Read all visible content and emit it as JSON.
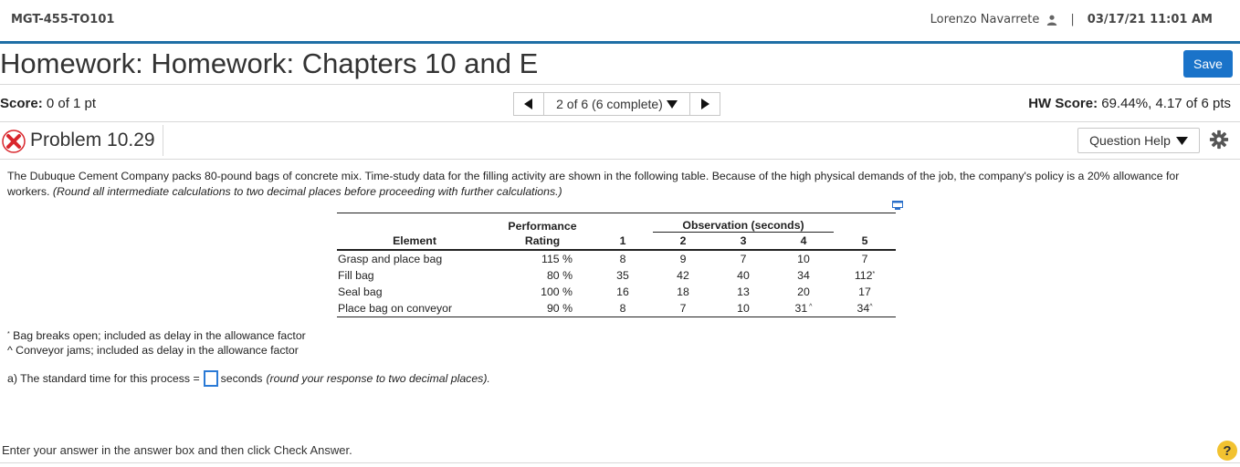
{
  "header": {
    "course": "MGT-455-TO101",
    "user_name": "Lorenzo Navarrete",
    "separator": "|",
    "datetime": "03/17/21 11:01 AM"
  },
  "title_row": {
    "title": "Homework: Homework: Chapters 10 and E",
    "save_label": "Save"
  },
  "score_row": {
    "score_label": "Score:",
    "score_value": " 0 of 1 pt",
    "nav_label": "2 of 6 (6 complete)",
    "hw_score_label": "HW Score:",
    "hw_score_value": " 69.44%, 4.17 of 6 pts"
  },
  "problem": {
    "title": "Problem 10.29",
    "help_label": "Question Help",
    "text": "The Dubuque Cement Company packs 80-pound bags of concrete mix. Time-study data for the filling activity are shown in the following table. Because of the high physical demands of the job, the company's policy is a 20% allowance for workers. ",
    "text_italic": "(Round all intermediate calculations to two decimal places before proceeding with further calculations.)"
  },
  "table": {
    "header_performance": "Performance",
    "header_observation": "Observation (seconds)",
    "header_element": "Element",
    "header_rating": "Rating",
    "obs_headers": [
      "1",
      "2",
      "3",
      "4",
      "5"
    ],
    "rows": [
      {
        "element": "Grasp and place bag",
        "rating": "115 %",
        "obs": [
          "8",
          "9",
          "7",
          "10",
          "7"
        ],
        "marks": [
          "",
          "",
          "",
          "",
          ""
        ]
      },
      {
        "element": "Fill bag",
        "rating": "80 %",
        "obs": [
          "35",
          "42",
          "40",
          "34",
          "112"
        ],
        "marks": [
          "",
          "",
          "",
          "",
          "*"
        ]
      },
      {
        "element": "Seal bag",
        "rating": "100 %",
        "obs": [
          "16",
          "18",
          "13",
          "20",
          "17"
        ],
        "marks": [
          "",
          "",
          "",
          "",
          ""
        ]
      },
      {
        "element": "Place bag on conveyor",
        "rating": "90 %",
        "obs": [
          "8",
          "7",
          "10",
          "31",
          "34"
        ],
        "marks": [
          "",
          "",
          "",
          " ^",
          "^"
        ]
      }
    ]
  },
  "footnotes": {
    "fn1_mark": "*",
    "fn1": " Bag breaks open; included as delay in the allowance factor",
    "fn2": "^ Conveyor jams; included as delay in the allowance factor"
  },
  "question": {
    "prefix": "a) The standard time for this process =",
    "answer_value": "",
    "unit": "seconds",
    "hint": "(round your response to two decimal places)."
  },
  "footer": {
    "instruction": "Enter your answer in the answer box and then click Check Answer.",
    "help_glyph": "?"
  },
  "colors": {
    "accent_rule": "#1f6fa6",
    "save_button": "#1a73c9",
    "error_icon": "#d9262c",
    "help_icon": "#f2c230"
  }
}
